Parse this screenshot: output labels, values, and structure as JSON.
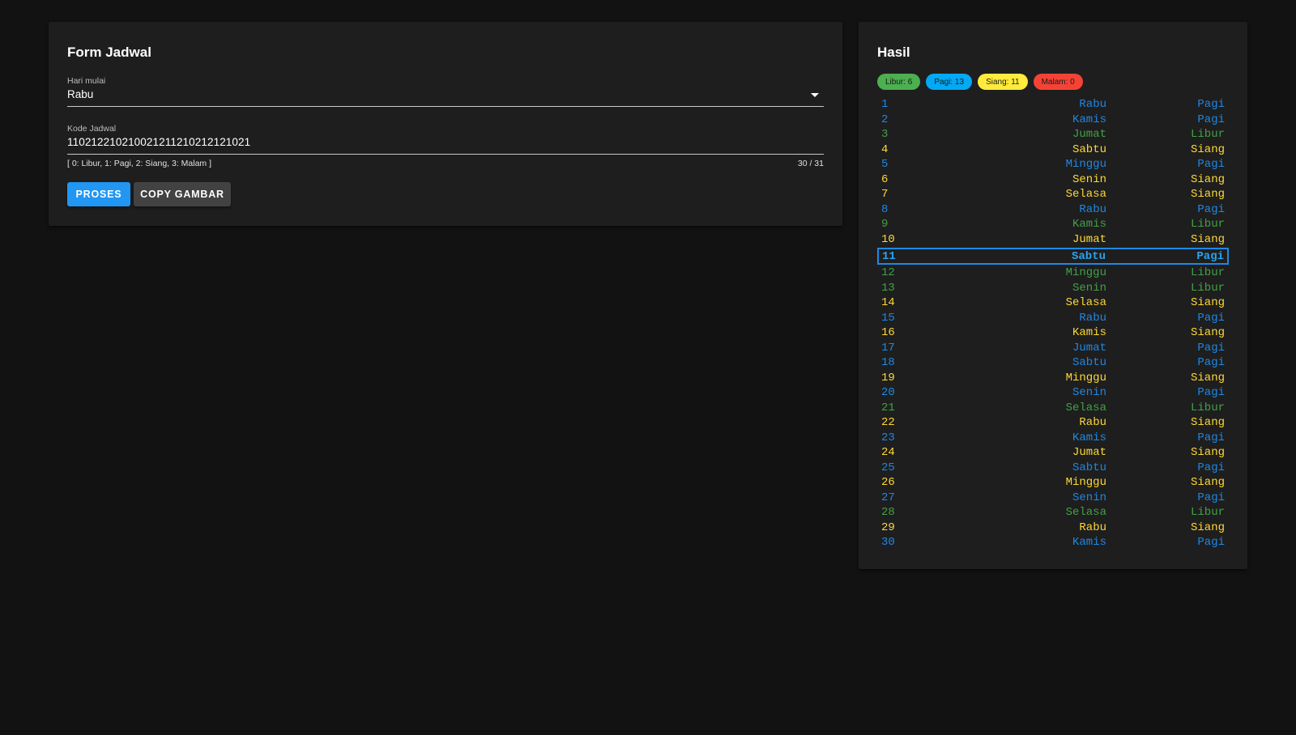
{
  "form": {
    "title": "Form Jadwal",
    "hari_label": "Hari mulai",
    "hari_value": "Rabu",
    "kode_label": "Kode Jadwal",
    "kode_value": "110212210210021211210212121021",
    "kode_hint": "[ 0: Libur, 1: Pagi, 2: Siang, 3: Malam ]",
    "kode_counter": "30 / 31",
    "btn_proses": "PROSES",
    "btn_copy": "COPY GAMBAR"
  },
  "result": {
    "title": "Hasil",
    "chips": {
      "libur": "Libur: 6",
      "pagi": "Pagi: 13",
      "siang": "Siang: 11",
      "malam": "Malam: 0"
    },
    "selected_row": 11,
    "rows": [
      {
        "num": "1",
        "day": "Rabu",
        "shift": "Pagi",
        "type": "pagi"
      },
      {
        "num": "2",
        "day": "Kamis",
        "shift": "Pagi",
        "type": "pagi"
      },
      {
        "num": "3",
        "day": "Jumat",
        "shift": "Libur",
        "type": "libur"
      },
      {
        "num": "4",
        "day": "Sabtu",
        "shift": "Siang",
        "type": "siang"
      },
      {
        "num": "5",
        "day": "Minggu",
        "shift": "Pagi",
        "type": "pagi"
      },
      {
        "num": "6",
        "day": "Senin",
        "shift": "Siang",
        "type": "siang"
      },
      {
        "num": "7",
        "day": "Selasa",
        "shift": "Siang",
        "type": "siang"
      },
      {
        "num": "8",
        "day": "Rabu",
        "shift": "Pagi",
        "type": "pagi"
      },
      {
        "num": "9",
        "day": "Kamis",
        "shift": "Libur",
        "type": "libur"
      },
      {
        "num": "10",
        "day": "Jumat",
        "shift": "Siang",
        "type": "siang"
      },
      {
        "num": "11",
        "day": "Sabtu",
        "shift": "Pagi",
        "type": "pagi"
      },
      {
        "num": "12",
        "day": "Minggu",
        "shift": "Libur",
        "type": "libur"
      },
      {
        "num": "13",
        "day": "Senin",
        "shift": "Libur",
        "type": "libur"
      },
      {
        "num": "14",
        "day": "Selasa",
        "shift": "Siang",
        "type": "siang"
      },
      {
        "num": "15",
        "day": "Rabu",
        "shift": "Pagi",
        "type": "pagi"
      },
      {
        "num": "16",
        "day": "Kamis",
        "shift": "Siang",
        "type": "siang"
      },
      {
        "num": "17",
        "day": "Jumat",
        "shift": "Pagi",
        "type": "pagi"
      },
      {
        "num": "18",
        "day": "Sabtu",
        "shift": "Pagi",
        "type": "pagi"
      },
      {
        "num": "19",
        "day": "Minggu",
        "shift": "Siang",
        "type": "siang"
      },
      {
        "num": "20",
        "day": "Senin",
        "shift": "Pagi",
        "type": "pagi"
      },
      {
        "num": "21",
        "day": "Selasa",
        "shift": "Libur",
        "type": "libur"
      },
      {
        "num": "22",
        "day": "Rabu",
        "shift": "Siang",
        "type": "siang"
      },
      {
        "num": "23",
        "day": "Kamis",
        "shift": "Pagi",
        "type": "pagi"
      },
      {
        "num": "24",
        "day": "Jumat",
        "shift": "Siang",
        "type": "siang"
      },
      {
        "num": "25",
        "day": "Sabtu",
        "shift": "Pagi",
        "type": "pagi"
      },
      {
        "num": "26",
        "day": "Minggu",
        "shift": "Siang",
        "type": "siang"
      },
      {
        "num": "27",
        "day": "Senin",
        "shift": "Pagi",
        "type": "pagi"
      },
      {
        "num": "28",
        "day": "Selasa",
        "shift": "Libur",
        "type": "libur"
      },
      {
        "num": "29",
        "day": "Rabu",
        "shift": "Siang",
        "type": "siang"
      },
      {
        "num": "30",
        "day": "Kamis",
        "shift": "Pagi",
        "type": "pagi"
      }
    ]
  },
  "colors": {
    "background": "#121212",
    "card": "#1e1e1e",
    "libur": "#43a047",
    "pagi": "#1e88e5",
    "siang": "#fdd835",
    "malam": "#e53935",
    "primary_button": "#2196f3",
    "secondary_button": "#424242"
  },
  "icons": {
    "hari_dropdown": "chevron-down-icon"
  }
}
